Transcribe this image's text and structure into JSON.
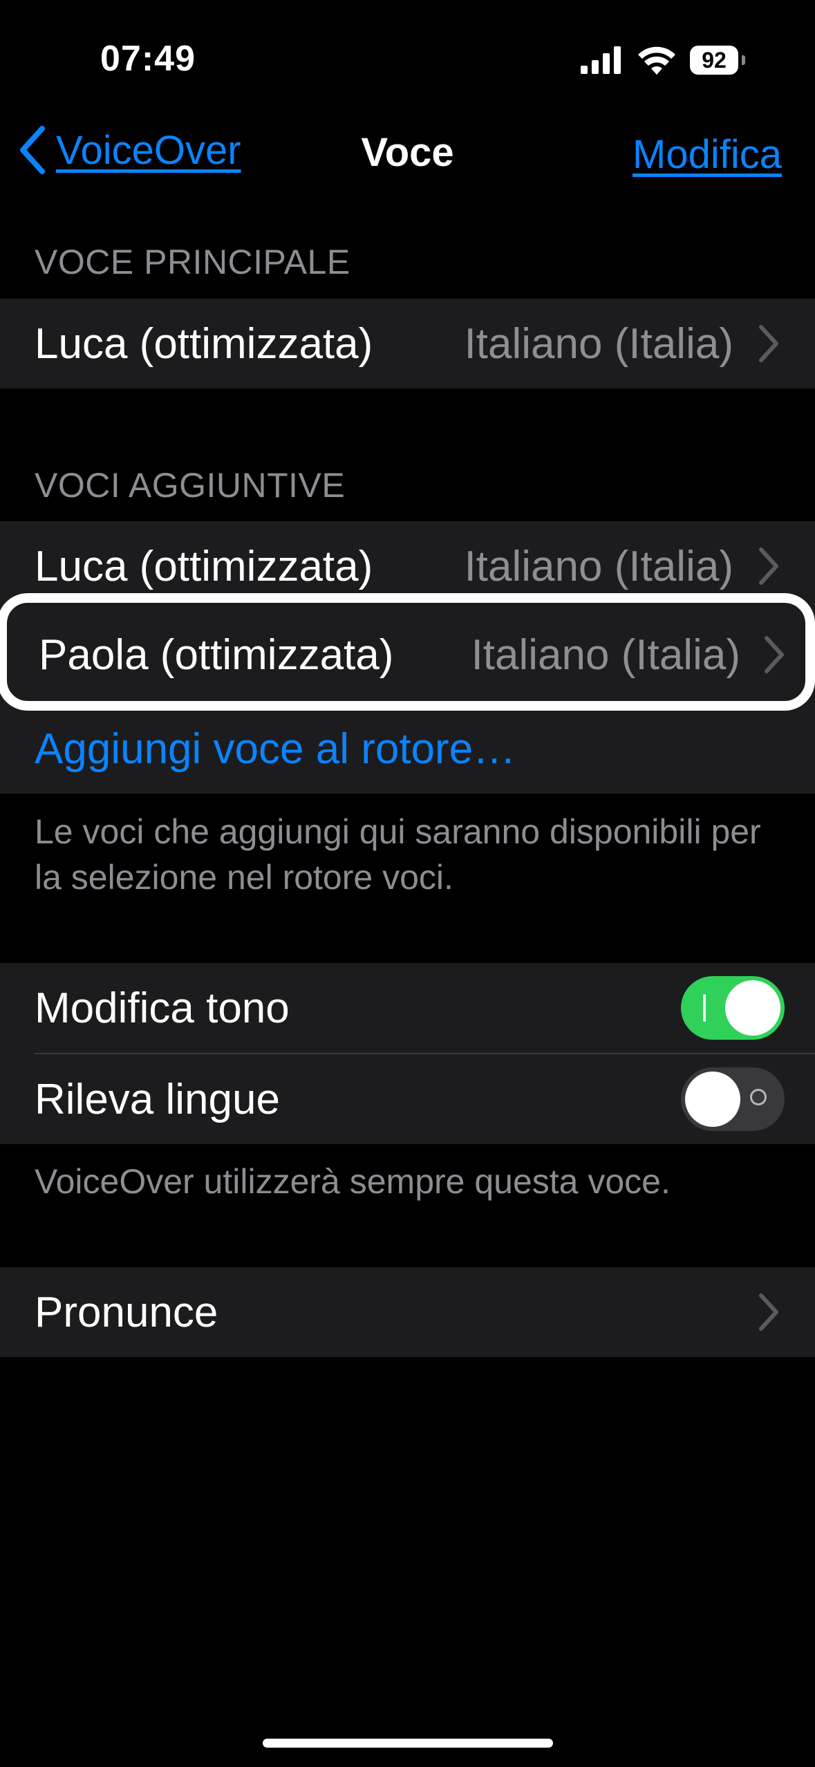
{
  "status_bar": {
    "time": "07:49",
    "battery": "92"
  },
  "nav": {
    "back_label": "VoiceOver",
    "title": "Voce",
    "edit_label": "Modifica"
  },
  "primary_voice": {
    "header": "VOCE PRINCIPALE",
    "name": "Luca (ottimizzata)",
    "language": "Italiano (Italia)"
  },
  "additional_voices": {
    "header": "VOCI AGGIUNTIVE",
    "items": [
      {
        "name": "Luca (ottimizzata)",
        "language": "Italiano (Italia)"
      },
      {
        "name": "Paola (ottimizzata)",
        "language": "Italiano (Italia)"
      }
    ],
    "add_label": "Aggiungi voce al rotore…",
    "footer": "Le voci che aggiungi qui saranno disponibili per la selezione nel rotore voci."
  },
  "options": {
    "pitch_change": {
      "label": "Modifica tono",
      "on": true
    },
    "detect_languages": {
      "label": "Rileva lingue",
      "on": false
    },
    "footer": "VoiceOver utilizzerà sempre questa voce."
  },
  "pronunciations": {
    "label": "Pronunce"
  },
  "colors": {
    "accent": "#0a84ff",
    "toggle_on": "#30d158",
    "cell_bg": "#1c1c1e"
  }
}
